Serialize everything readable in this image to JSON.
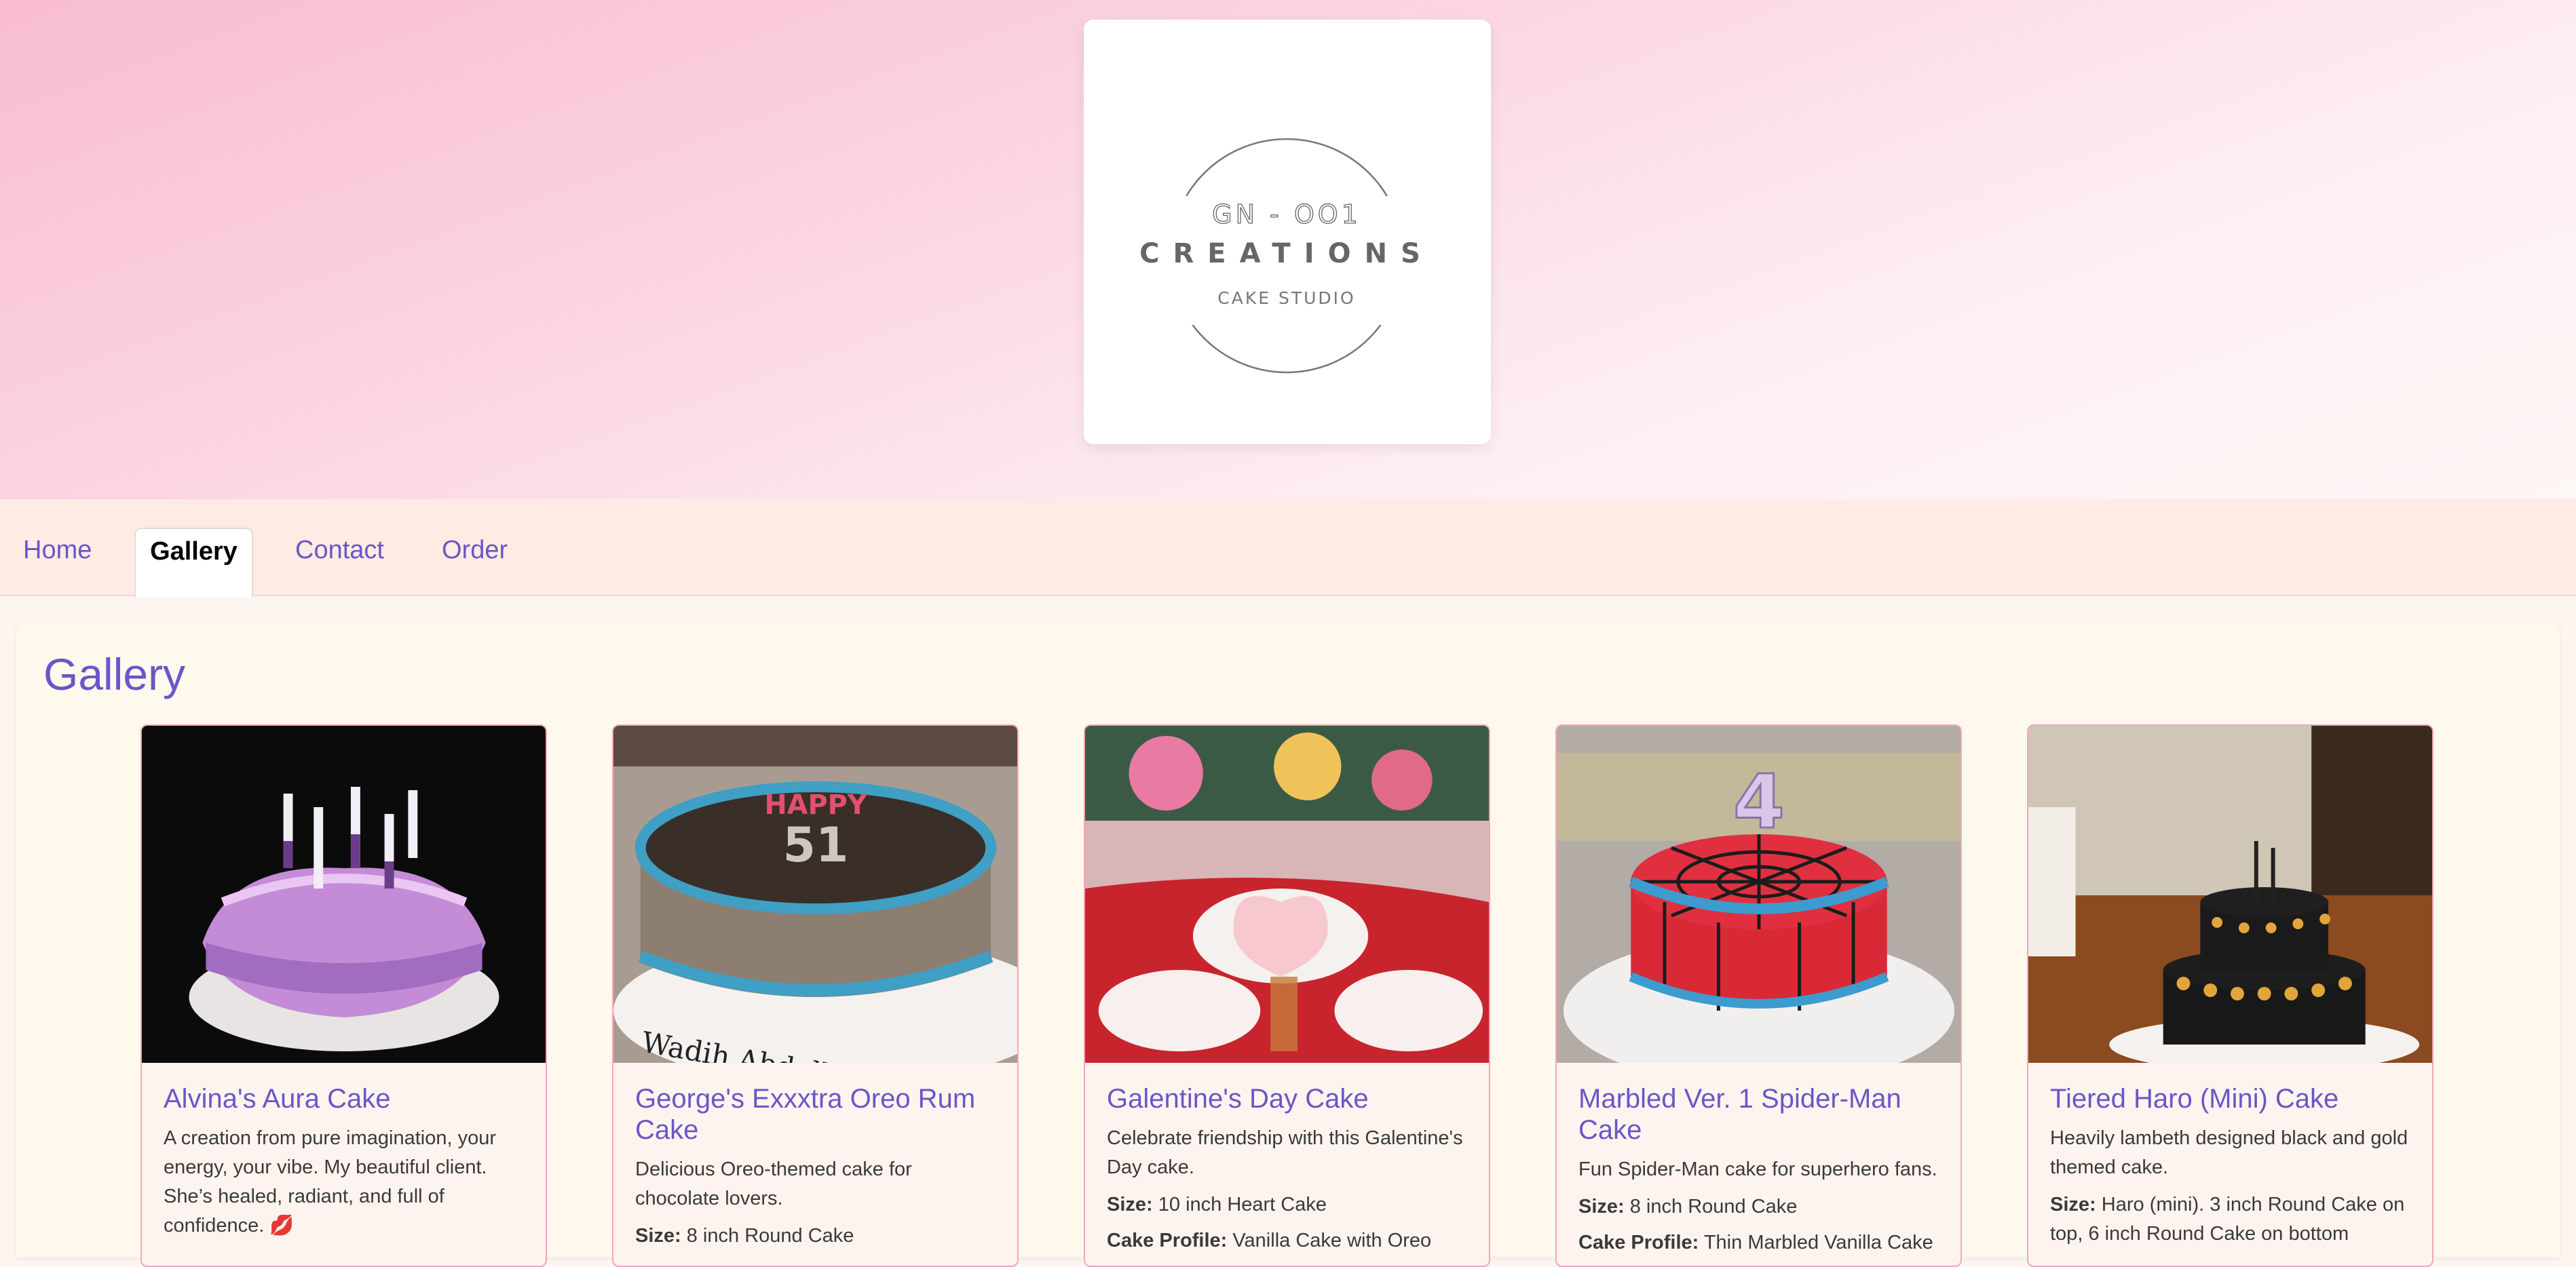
{
  "logo": {
    "top_line": "GN - OO1",
    "brand": "CREATIONS",
    "tagline": "CAKE STUDIO"
  },
  "nav": {
    "tabs": [
      {
        "label": "Home",
        "active": false
      },
      {
        "label": "Gallery",
        "active": true
      },
      {
        "label": "Contact",
        "active": false
      },
      {
        "label": "Order",
        "active": false
      }
    ]
  },
  "gallery": {
    "title": "Gallery",
    "items": [
      {
        "title": "Alvina's Aura Cake",
        "description": "A creation from pure imagination, your energy, your vibe. My beautiful client. She’s healed, radiant, and full of confidence. 💋"
      },
      {
        "title": "George's Exxxtra Oreo Rum Cake",
        "description": "Delicious Oreo-themed cake for chocolate lovers.",
        "size_label": "Size:",
        "size_value": "8 inch Round Cake"
      },
      {
        "title": "Galentine's Day Cake",
        "description": "Celebrate friendship with this Galentine's Day cake.",
        "size_label": "Size:",
        "size_value": "10 inch Heart Cake",
        "profile_label": "Cake Profile:",
        "profile_value": "Vanilla Cake with Oreo"
      },
      {
        "title": "Marbled Ver. 1 Spider-Man Cake",
        "description": "Fun Spider-Man cake for superhero fans.",
        "size_label": "Size:",
        "size_value": "8 inch Round Cake",
        "profile_label": "Cake Profile:",
        "profile_value": "Thin Marbled Vanilla Cake"
      },
      {
        "title": "Tiered Haro (Mini) Cake",
        "description": "Heavily lambeth designed black and gold themed cake.",
        "size_label": "Size:",
        "size_value": "Haro (mini). 3 inch Round Cake on top, 6 inch Round Cake on bottom"
      }
    ]
  },
  "colors": {
    "accent": "#6a56c8",
    "card_border": "#f2a6bd",
    "hero_pink": "#f8bcd2"
  }
}
